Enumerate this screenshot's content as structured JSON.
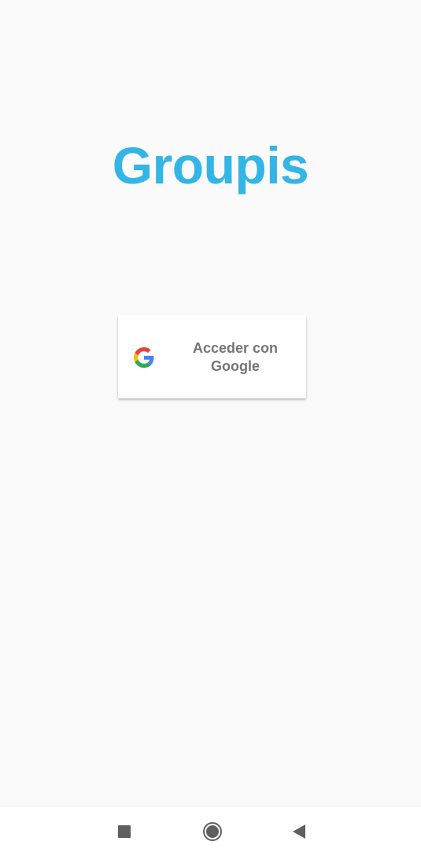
{
  "app": {
    "title": "Groupis",
    "title_color": "#33b5e5",
    "background_color": "#fafafa"
  },
  "sign_in": {
    "label_line1": "Acceder con",
    "label_line2": "Google",
    "icon": "google-g-logo-icon",
    "label_color": "#757575"
  },
  "navigation_bar": {
    "buttons": [
      {
        "icon": "recents-square-icon"
      },
      {
        "icon": "home-circle-icon"
      },
      {
        "icon": "back-triangle-icon"
      }
    ]
  }
}
